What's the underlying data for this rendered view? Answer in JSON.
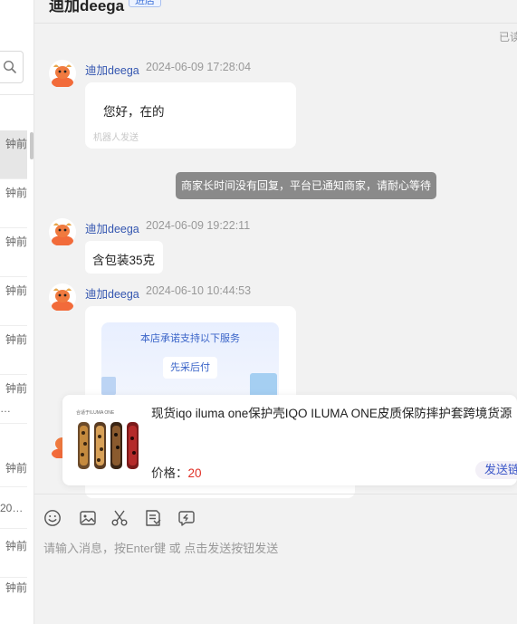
{
  "header": {
    "contact_name": "迪加deega",
    "tag": "进店"
  },
  "read_status": "已读",
  "conversation_list": [
    {
      "time": "钟前",
      "preview": ""
    },
    {
      "time": "钟前",
      "preview": ""
    },
    {
      "time": "钟前",
      "preview": ""
    },
    {
      "time": "钟前",
      "preview": ""
    },
    {
      "time": "钟前",
      "preview": ""
    },
    {
      "time": "钟前",
      "preview": "…"
    },
    {
      "time": "钟前",
      "preview": "20…"
    },
    {
      "time": "钟前",
      "preview": ""
    },
    {
      "time": "钟前",
      "preview": ""
    }
  ],
  "messages": [
    {
      "sender": "迪加deega",
      "time": "2024-06-09 17:28:04",
      "text": "您好，在的",
      "note": "机器人发送"
    },
    {
      "sender": "迪加deega",
      "time": "2024-06-09 19:22:11",
      "text": "含包装35克"
    },
    {
      "sender": "迪加deega",
      "time": "2024-06-10 10:44:53",
      "card_title": "本店承诺支持以下服务",
      "card_button": "先采后付"
    }
  ],
  "system_notice": "商家长时间没有回复，平台已通知商家，请耐心等待",
  "product_card": {
    "title": "现货iqo iluma one保护壳IQO ILUMA ONE皮质保防摔护套跨境货源",
    "price_label": "价格：",
    "price_value": "20",
    "send_label": "发送链",
    "thumb_caption": "合适于ILUMA ONE"
  },
  "toolbar": {
    "icons": [
      "emoji-icon",
      "image-icon",
      "scissors-icon",
      "order-icon",
      "quick-reply-icon"
    ]
  },
  "input": {
    "placeholder": "请输入消息，按Enter键 或 点击发送按钮发送"
  },
  "colors": {
    "accent_blue": "#3456b0",
    "price_red": "#e02e24",
    "system_notice_bg": "#8a8a8a",
    "avatar_orange": "#f26b3a"
  }
}
